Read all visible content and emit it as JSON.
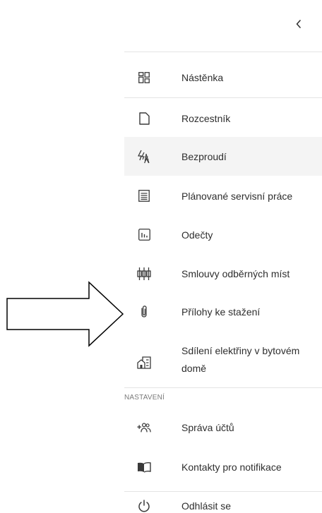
{
  "menu": {
    "items": [
      {
        "label": "Nástěnka",
        "icon": "dashboard-icon"
      },
      {
        "label": "Rozcestník",
        "icon": "document-icon"
      },
      {
        "label": "Bezproudí",
        "icon": "power-outage-icon"
      },
      {
        "label": "Plánované servisní práce",
        "icon": "list-document-icon"
      },
      {
        "label": "Odečty",
        "icon": "chart-icon"
      },
      {
        "label": "Smlouvy odběrných míst",
        "icon": "sliders-icon"
      },
      {
        "label": "Přílohy ke stažení",
        "icon": "paperclip-icon"
      },
      {
        "label_line1": "Sdílení elektřiny v bytovém",
        "label_line2": "domě",
        "icon": "building-icon"
      }
    ]
  },
  "settings": {
    "section_label": "NASTAVENÍ",
    "items": [
      {
        "label": "Správa účtů",
        "icon": "add-users-icon"
      },
      {
        "label": "Kontakty pro notifikace",
        "icon": "book-icon"
      },
      {
        "label": "Odhlásit se",
        "icon": "power-icon"
      }
    ]
  },
  "colors": {
    "active_bg": "#f4f4f4",
    "divider": "#e4e4e4",
    "icon": "#3a3a3a"
  }
}
